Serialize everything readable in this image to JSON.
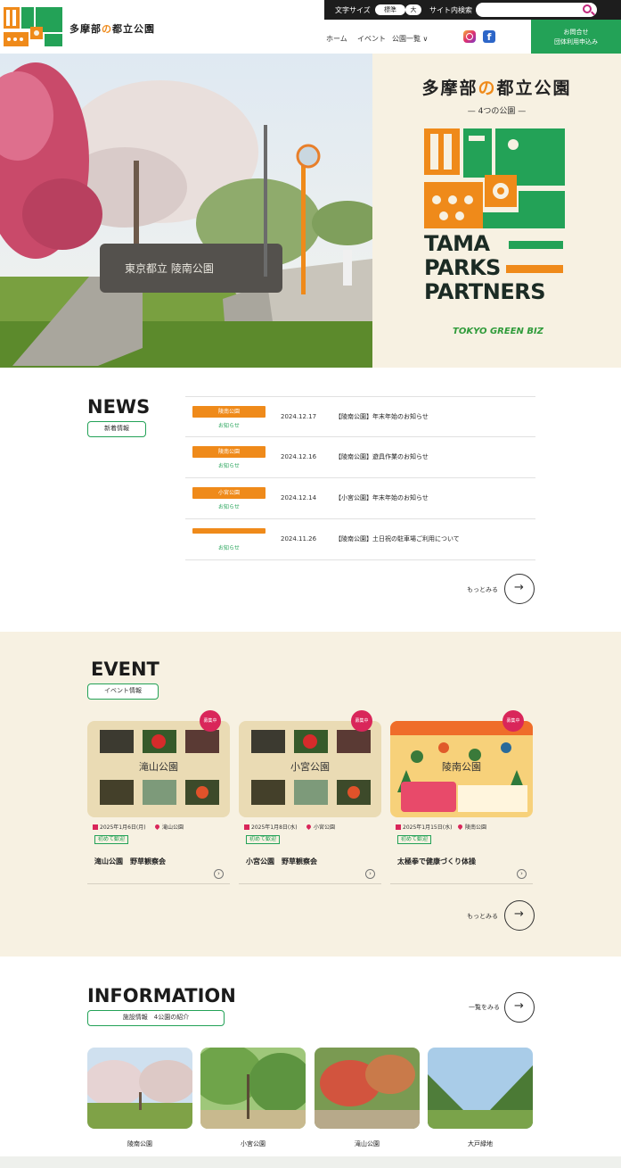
{
  "header": {
    "site_name_a": "多摩部",
    "site_name_b": "の",
    "site_name_c": "都立公園",
    "font_size_label": "文字サイズ",
    "font_size_standard": "標準",
    "font_size_large": "大",
    "site_search_label": "サイト内検索",
    "nav": [
      "ホーム",
      "イベント",
      "公園一覧 ∨"
    ],
    "contact_line1": "お問合せ",
    "contact_line2": "団体利用申込み"
  },
  "hero": {
    "title_a": "多摩部",
    "title_b": "の",
    "title_c": "都立公園",
    "subtitle": "— 4つの公園 —",
    "brand_lines": [
      "TAMA",
      "PARKS",
      "PARTNERS"
    ],
    "partner_logo": "TOKYO GREEN BIZ",
    "sign_text": "東京都立 陵南公園"
  },
  "news": {
    "heading": "NEWS",
    "tag": "新着情報",
    "items": [
      {
        "category": "陵南公園",
        "type": "お知らせ",
        "date": "2024.12.17",
        "title": "【陵南公園】年末年始のお知らせ"
      },
      {
        "category": "陵南公園",
        "type": "お知らせ",
        "date": "2024.12.16",
        "title": "【陵南公園】遊具作業のお知らせ"
      },
      {
        "category": "小宮公園",
        "type": "お知らせ",
        "date": "2024.12.14",
        "title": "【小宮公園】年末年始のお知らせ"
      },
      {
        "category": "",
        "type": "お知らせ",
        "date": "2024.11.26",
        "title": "【陵南公園】土日祝の駐車場ご利用について"
      }
    ],
    "more": "もっとみる"
  },
  "event": {
    "heading": "EVENT",
    "tag": "イベント情報",
    "cards": [
      {
        "badge": "募集中",
        "image_label": "滝山公園",
        "date": "2025年1月6日(月)",
        "location": "滝山公園",
        "chip": "初めて歓迎",
        "title": "滝山公園　野草観察会"
      },
      {
        "badge": "募集中",
        "image_label": "小宮公園",
        "date": "2025年1月8日(水)",
        "location": "小宮公園",
        "chip": "初めて歓迎",
        "title": "小宮公園　野草観察会"
      },
      {
        "badge": "募集中",
        "image_label": "陵南公園",
        "date": "2025年1月15日(水)",
        "location": "陵南公園",
        "chip": "初めて歓迎",
        "title": "太極拳で健康づくり体操"
      }
    ],
    "more": "もっとみる"
  },
  "information": {
    "heading": "INFORMATION",
    "tag": "施設情報　4公園の紹介",
    "more": "一覧をみる",
    "parks": [
      "陵南公園",
      "小宮公園",
      "滝山公園",
      "大戸緑地"
    ]
  },
  "colors": {
    "green": "#23a257",
    "orange": "#ef8a1a",
    "pink": "#d9265a",
    "cream": "#f7f1e2"
  },
  "icons": [
    "search-icon",
    "instagram-icon",
    "facebook-icon",
    "arrow-right-icon",
    "calendar-icon",
    "pin-icon"
  ]
}
